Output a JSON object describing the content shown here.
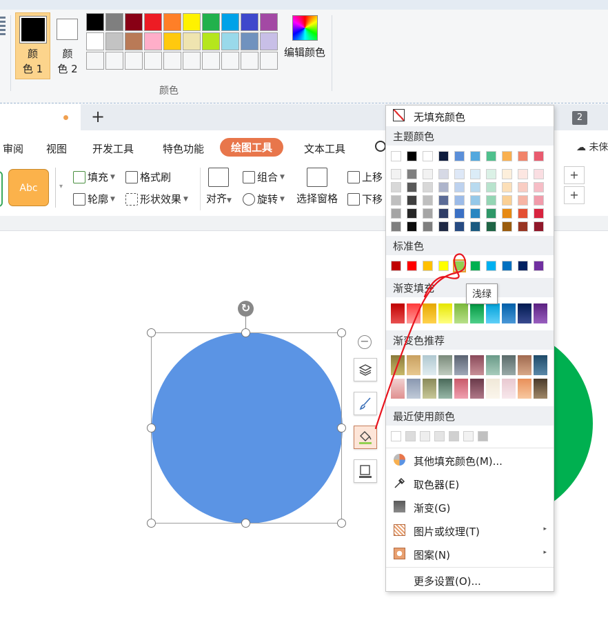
{
  "paint": {
    "color1_label": "颜\n色 1",
    "color2_label": "颜\n色 2",
    "edit_colors_label": "编辑颜色",
    "group_label": "颜色",
    "palette_row1": [
      "#000000",
      "#7f7f7f",
      "#880015",
      "#ed1c24",
      "#ff7f27",
      "#fff200",
      "#22b14c",
      "#00a2e8",
      "#3f48cc",
      "#a349a4"
    ],
    "palette_row2": [
      "#ffffff",
      "#c3c3c3",
      "#b97a57",
      "#ffaec9",
      "#ffc90e",
      "#efe4b0",
      "#b5e61d",
      "#99d9ea",
      "#7092be",
      "#c8bfe7"
    ],
    "palette_row3": [
      "#f5f6f7",
      "#f5f6f7",
      "#f5f6f7",
      "#f5f6f7",
      "#f5f6f7",
      "#f5f6f7",
      "#f5f6f7",
      "#f5f6f7",
      "#f5f6f7",
      "#f5f6f7"
    ]
  },
  "tabs": {
    "new_tab": "+",
    "tab_count": "2"
  },
  "menu": {
    "items": [
      "审阅",
      "视图",
      "开发工具",
      "特色功能",
      "绘图工具",
      "文本工具"
    ],
    "cloud": "未俫"
  },
  "toolbar": {
    "style_sample": "Abc",
    "fill": "填充",
    "outline": "轮廓",
    "format_painter": "格式刷",
    "shape_effects": "形状效果",
    "align": "对齐",
    "group": "组合",
    "rotate": "旋转",
    "selection_pane": "选择窗格",
    "move_up": "上移",
    "move_down": "下移",
    "spin_plus": "+"
  },
  "canvas": {
    "blue_circle_color": "#5b94e4",
    "green_circle_color": "#00b050",
    "rotate_glyph": "↻",
    "minus_glyph": "−"
  },
  "dropdown": {
    "no_fill": "无填充颜色",
    "theme_colors": "主题颜色",
    "theme_row": [
      "#ffffff",
      "#000000",
      "#ffffff",
      "#0e1c3d",
      "#5b8fd9",
      "#52a8de",
      "#4fc08d",
      "#f9b04f",
      "#f1846a",
      "#e95b6f"
    ],
    "theme_shades": [
      [
        "#f2f2f2",
        "#7f7f7f",
        "#f2f2f2",
        "#d6d9e5",
        "#dee8f7",
        "#dbecf7",
        "#dbf1e6",
        "#fdefdb",
        "#fce6e1",
        "#fadee2"
      ],
      [
        "#d8d8d8",
        "#595959",
        "#d8d8d8",
        "#adb4cb",
        "#bdd2ef",
        "#b8daef",
        "#b8e3cd",
        "#fcdfb8",
        "#f9cdc3",
        "#f6bdc6"
      ],
      [
        "#bfbfbf",
        "#3f3f3f",
        "#bfbfbf",
        "#5b6b96",
        "#9cbbe8",
        "#95c8e8",
        "#94d5b4",
        "#fad095",
        "#f6b5a5",
        "#f19cab"
      ],
      [
        "#a5a5a5",
        "#262626",
        "#a5a5a5",
        "#2f3d66",
        "#3b70c4",
        "#2986c1",
        "#2f9768",
        "#e78a13",
        "#e45033",
        "#d8243f"
      ],
      [
        "#7f7f7f",
        "#0c0c0c",
        "#7f7f7f",
        "#1f2944",
        "#274b82",
        "#1b5a80",
        "#1f6545",
        "#9a5c0d",
        "#983522",
        "#90182a"
      ]
    ],
    "standard_colors": "标准色",
    "standard_row": [
      "#c00000",
      "#ff0000",
      "#ffc000",
      "#ffff00",
      "#92d050",
      "#00b050",
      "#00b0f0",
      "#0070c0",
      "#002060",
      "#7030a0"
    ],
    "gradient_fill": "渐变填充",
    "gradient_row": [
      [
        "#c00000",
        "#e85050"
      ],
      [
        "#ff3a3a",
        "#ff9a9a"
      ],
      [
        "#e6a800",
        "#ffd24d"
      ],
      [
        "#e6e600",
        "#ffff80"
      ],
      [
        "#7ab83a",
        "#b8e08a"
      ],
      [
        "#00963f",
        "#50d08a"
      ],
      [
        "#00a0d8",
        "#60d0f8"
      ],
      [
        "#005ea8",
        "#4a98d8"
      ],
      [
        "#001a50",
        "#3a4a90"
      ],
      [
        "#5a2080",
        "#9a60c0"
      ]
    ],
    "gradient_recommended": "渐变色推荐",
    "recommended_row1": [
      [
        "#8a7a3a",
        "#c8b868"
      ],
      [
        "#c8a060",
        "#e8c890"
      ],
      [
        "#b0c8d0",
        "#e0ecf0"
      ],
      [
        "#7a8a7a",
        "#c0ccc0"
      ],
      [
        "#5a6270",
        "#a0a8b8"
      ],
      [
        "#8a4a5a",
        "#c89098"
      ],
      [
        "#6a9a88",
        "#a8ccbc"
      ],
      [
        "#5a6a6a",
        "#9aaaa8"
      ],
      [
        "#a06a50",
        "#d8a888"
      ],
      [
        "#1e4a68",
        "#5a88a8"
      ]
    ],
    "recommended_row2": [
      [
        "#f0d0d0",
        "#e09090"
      ],
      [
        "#8a98b0",
        "#c0cad8"
      ],
      [
        "#8a8a5a",
        "#c8c898"
      ],
      [
        "#4a6a5a",
        "#98b8a8"
      ],
      [
        "#c85a6a",
        "#f0a0b0"
      ],
      [
        "#6a3a4a",
        "#b07888"
      ],
      [
        "#f0e8d8",
        "#fbf6ec"
      ],
      [
        "#e8c8d0",
        "#f8e8ec"
      ],
      [
        "#e8905a",
        "#f8c8a0"
      ],
      [
        "#4a3a2a",
        "#a08868"
      ]
    ],
    "recent_colors": "最近使用颜色",
    "recent_row": [
      "#ffffff",
      "#dcdcdc",
      "#eeeeee",
      "#e4e4e4",
      "#d0d0d0",
      "#f2f2f2",
      "#c0c0c0"
    ],
    "more_fill_colors": "其他填充颜色(M)...",
    "eyedropper": "取色器(E)",
    "gradient": "渐变(G)",
    "picture_texture": "图片或纹理(T)",
    "pattern": "图案(N)",
    "more_settings": "更多设置(O)..."
  },
  "tooltip": "浅绿",
  "annotation_color": "#e8141e"
}
